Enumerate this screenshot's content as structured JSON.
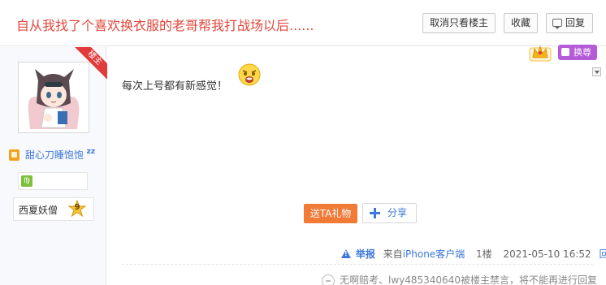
{
  "thread": {
    "title": "自从我找了个喜欢换衣服的老哥帮我打战场以后......"
  },
  "header_buttons": {
    "only_author": "取消只看楼主",
    "favorite": "收藏",
    "reply": "回复"
  },
  "author": {
    "name": "甜心刀睡饱饱",
    "sleep_mark": "zz",
    "owner_ribbon": "楼主",
    "zodiac_glyph": "♍",
    "level_name": "西夏妖僧",
    "level": "9"
  },
  "vip": {
    "label": "换尊"
  },
  "post": {
    "text": "每次上号都有新感觉！"
  },
  "actions": {
    "gift": "送TA礼物",
    "share": "分享"
  },
  "meta": {
    "report": "举报",
    "source_prefix": "来自",
    "source_client": "iPhone客户端",
    "floor": "1楼",
    "datetime": "2021-05-10 16:52",
    "reply": "回复"
  },
  "notice": {
    "text": "无啊赔考、lwy485340640被楼主禁言，将不能再进行回复"
  },
  "colors": {
    "title_red": "#e1473b",
    "link_blue": "#3d78d8",
    "gift_orange": "#f07a36",
    "vip_purple": "#b65bd8"
  },
  "icons": [
    "reply-icon",
    "author-badge-icon",
    "zodiac-icon",
    "level-star-icon",
    "vip-crown-icon",
    "emoji-shock-icon",
    "share-plus-icon",
    "report-icon",
    "notice-icon",
    "scroll-arrow-icon"
  ]
}
